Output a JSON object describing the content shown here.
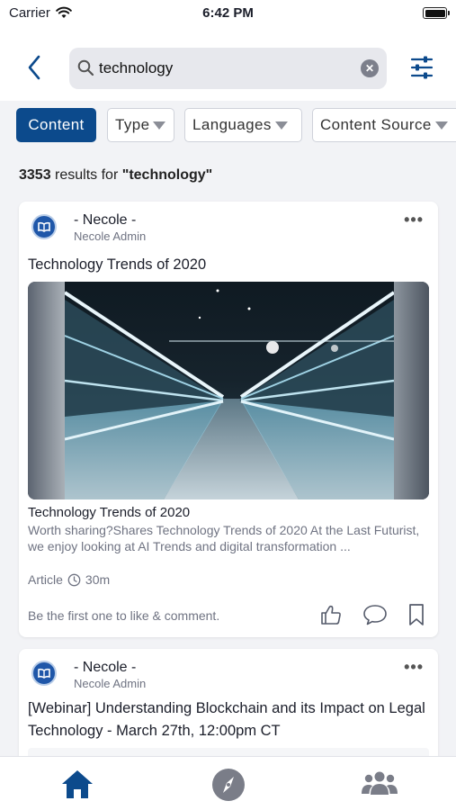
{
  "status": {
    "carrier": "Carrier",
    "time": "6:42 PM"
  },
  "search": {
    "value": "technology"
  },
  "chips": [
    {
      "label": "Content",
      "active": true
    },
    {
      "label": "Type"
    },
    {
      "label": "Languages"
    },
    {
      "label": "Content Source"
    }
  ],
  "results": {
    "count": "3353",
    "text": " results for ",
    "query": "\"technology\""
  },
  "posts": [
    {
      "author": "- Necole -",
      "role": "Necole Admin",
      "title": "Technology Trends of 2020",
      "link_title": "Technology Trends of 2020",
      "link_desc": "Worth sharing?Shares Technology Trends of 2020 At the Last Futurist, we enjoy looking at AI Trends and digital transformation ...",
      "type": "Article",
      "duration": "30m",
      "engagement": "Be the first one to like & comment."
    },
    {
      "author": "- Necole -",
      "role": "Necole Admin",
      "title": "[Webinar] Understanding Blockchain and its Impact on Legal Technology - March 27th, 12:00pm CT"
    }
  ],
  "colors": {
    "accent": "#0c4a8c",
    "icon_gray": "#7a7d88"
  },
  "icons": {
    "back": "chevron-left-icon",
    "search": "search-icon",
    "clear": "clear-icon",
    "filter": "sliders-icon",
    "home": "home-icon",
    "explore": "compass-icon",
    "community": "group-icon"
  }
}
